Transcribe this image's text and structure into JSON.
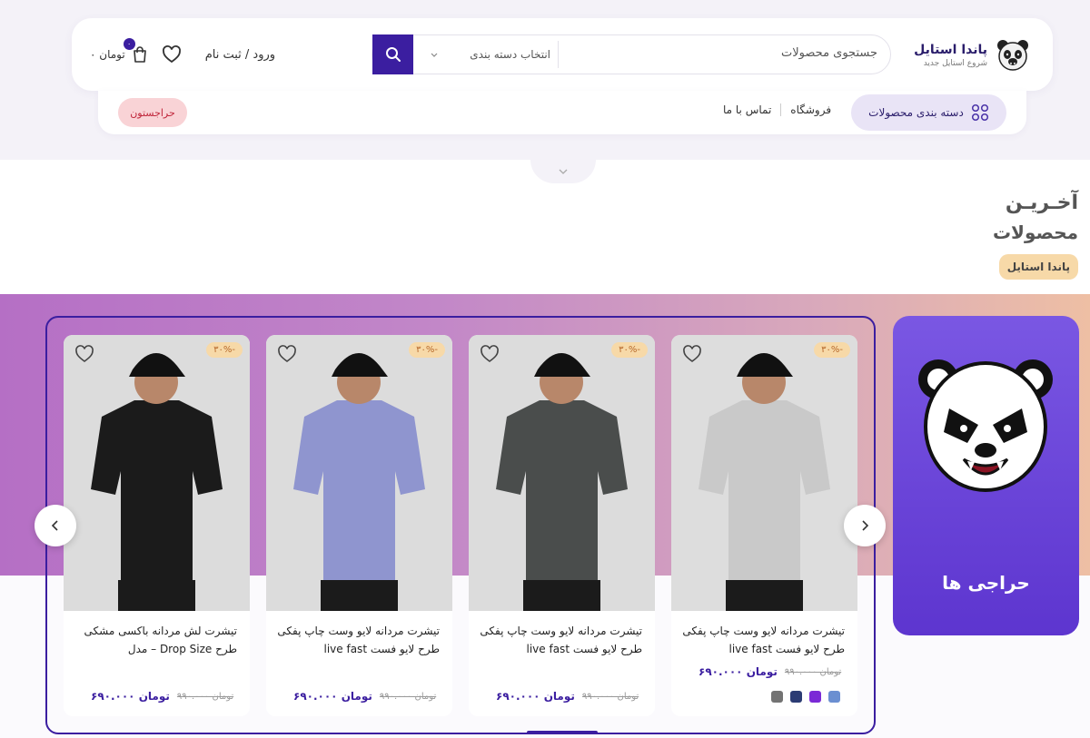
{
  "header": {
    "brand_name": "پاندا استایل",
    "brand_tagline": "شروع استایل جدید",
    "search_placeholder": "جستجوی محصولات",
    "category_select": "انتخاب دسته بندی",
    "login_label": "ورود / ثبت نام",
    "cart_badge": "۰",
    "cart_total": "۰ تومان"
  },
  "nav": {
    "categories_label": "دسته بندی محصولات",
    "links": [
      "فروشگاه",
      "تماس با ما"
    ],
    "sale_button": "حراجستون"
  },
  "section": {
    "title_line1": "آخـریـن",
    "title_line2": "محصولات",
    "brand_tag": "پاندا استایل"
  },
  "deals": {
    "label": "حراجی ها"
  },
  "products": [
    {
      "name": "تیشرت مردانه لایو وست چاپ پفکی طرح لایو فست live fast",
      "discount": "۳۰%-",
      "price_old": "۹۹۰.۰۰۰ تومان",
      "price_new": "۶۹۰.۰۰۰ تومان",
      "shirt_color": "#c9c9c9",
      "swatches": [
        "#6b8fd1",
        "#7b2ad6",
        "#2c3c74",
        "#737373"
      ]
    },
    {
      "name": "تیشرت مردانه لایو وست چاپ پفکی طرح لایو فست live fast",
      "discount": "۳۰%-",
      "price_old": "۹۹۰.۰۰۰ تومان",
      "price_new": "۶۹۰.۰۰۰ تومان",
      "shirt_color": "#4a4d4c"
    },
    {
      "name": "تیشرت مردانه لایو وست چاپ پفکی طرح لایو فست live fast",
      "discount": "۳۰%-",
      "price_old": "۹۹۰.۰۰۰ تومان",
      "price_new": "۶۹۰.۰۰۰ تومان",
      "shirt_color": "#8f95cf"
    },
    {
      "name": "تیشرت لش مردانه باکسی مشکی طرح Drop Size – مدل",
      "discount": "۳۰%-",
      "price_old": "۹۹۰.۰۰۰ تومان",
      "price_new": "۶۹۰.۰۰۰ تومان",
      "shirt_color": "#1b1b1b"
    }
  ],
  "colors": {
    "accent": "#3b1ea0",
    "deal_card": "#6a44d8",
    "sale_pink": "#f9d3d6",
    "tag_gold": "#f7d9a8"
  }
}
